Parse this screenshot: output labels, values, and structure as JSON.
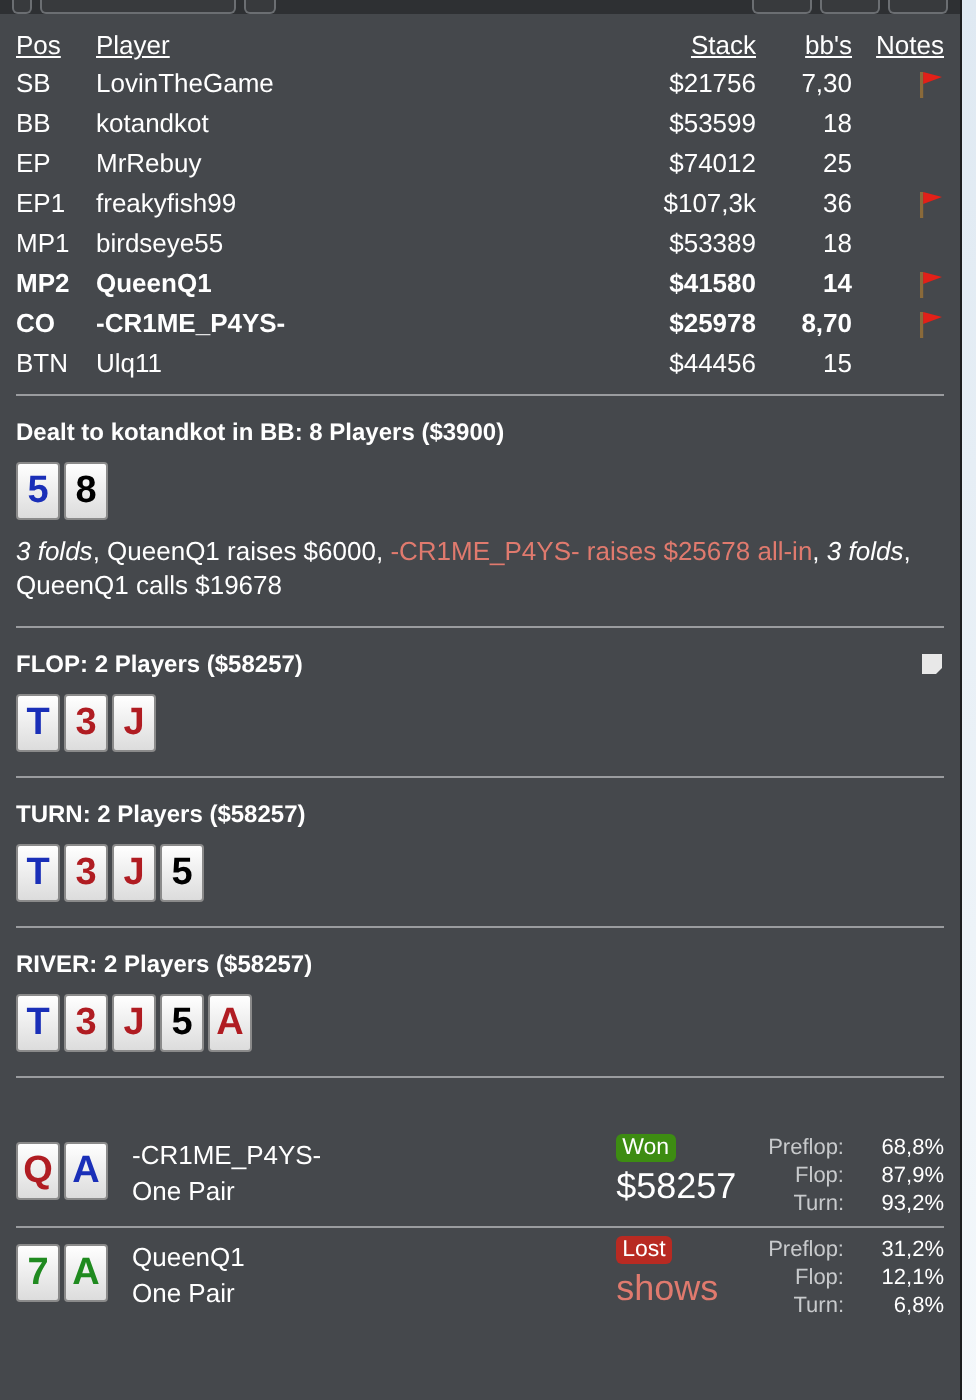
{
  "columns": [
    "Pos",
    "Player",
    "Stack",
    "bb's",
    "Notes"
  ],
  "players": [
    {
      "pos": "SB",
      "name": "LovinTheGame",
      "stack": "$21756",
      "bbs": "7,30",
      "highlighted": false,
      "flagged": true
    },
    {
      "pos": "BB",
      "name": "kotandkot",
      "stack": "$53599",
      "bbs": "18",
      "highlighted": false,
      "flagged": false
    },
    {
      "pos": "EP",
      "name": "MrRebuy",
      "stack": "$74012",
      "bbs": "25",
      "highlighted": false,
      "flagged": false
    },
    {
      "pos": "EP1",
      "name": "freakyfish99",
      "stack": "$107,3k",
      "bbs": "36",
      "highlighted": false,
      "flagged": true
    },
    {
      "pos": "MP1",
      "name": "birdseye55",
      "stack": "$53389",
      "bbs": "18",
      "highlighted": false,
      "flagged": false
    },
    {
      "pos": "MP2",
      "name": "QueenQ1",
      "stack": "$41580",
      "bbs": "14",
      "highlighted": true,
      "flagged": true
    },
    {
      "pos": "CO",
      "name": "-CR1ME_P4YS-",
      "stack": "$25978",
      "bbs": "8,70",
      "highlighted": true,
      "flagged": true
    },
    {
      "pos": "BTN",
      "name": "Ulq11",
      "stack": "$44456",
      "bbs": "15",
      "highlighted": false,
      "flagged": false
    }
  ],
  "streets": [
    {
      "title": "Dealt to kotandkot in BB: 8 Players ($3900)",
      "note": false,
      "cards": [
        {
          "rank": "5",
          "color": "#1a2fb8"
        },
        {
          "rank": "8",
          "color": "#000000"
        }
      ],
      "actions": [
        {
          "kind": "fold",
          "text": "3 folds"
        },
        {
          "kind": "plain",
          "text": ", QueenQ1 raises $6000, "
        },
        {
          "kind": "allin",
          "text": "-CR1ME_P4YS- raises $25678 all-in"
        },
        {
          "kind": "plain",
          "text": ", "
        },
        {
          "kind": "fold",
          "text": "3 folds"
        },
        {
          "kind": "plain",
          "text": ", QueenQ1 calls $19678"
        }
      ]
    },
    {
      "title": "FLOP: 2 Players ($58257)",
      "note": true,
      "cards": [
        {
          "rank": "T",
          "color": "#1a2fb8"
        },
        {
          "rank": "3",
          "color": "#b01c22"
        },
        {
          "rank": "J",
          "color": "#b01c22"
        }
      ]
    },
    {
      "title": "TURN: 2 Players ($58257)",
      "note": false,
      "cards": [
        {
          "rank": "T",
          "color": "#1a2fb8"
        },
        {
          "rank": "3",
          "color": "#b01c22"
        },
        {
          "rank": "J",
          "color": "#b01c22"
        },
        {
          "rank": "5",
          "color": "#000000"
        }
      ]
    },
    {
      "title": "RIVER: 2 Players ($58257)",
      "note": false,
      "cards": [
        {
          "rank": "T",
          "color": "#1a2fb8"
        },
        {
          "rank": "3",
          "color": "#b01c22"
        },
        {
          "rank": "J",
          "color": "#b01c22"
        },
        {
          "rank": "5",
          "color": "#000000"
        },
        {
          "rank": "A",
          "color": "#b01c22"
        }
      ]
    }
  ],
  "results": [
    {
      "cards": [
        {
          "rank": "Q",
          "color": "#b01c22"
        },
        {
          "rank": "A",
          "color": "#1a2fb8"
        }
      ],
      "player": "-CR1ME_P4YS-",
      "hand": "One Pair",
      "kind": "won",
      "badge": "Won",
      "amount": "$58257",
      "equity": [
        {
          "label": "Preflop:",
          "value": "68,8%"
        },
        {
          "label": "Flop:",
          "value": "87,9%"
        },
        {
          "label": "Turn:",
          "value": "93,2%"
        }
      ]
    },
    {
      "cards": [
        {
          "rank": "7",
          "color": "#1f8a1f"
        },
        {
          "rank": "A",
          "color": "#1f8a1f"
        }
      ],
      "player": "QueenQ1",
      "hand": "One Pair",
      "kind": "lost",
      "badge": "Lost",
      "amount": "shows",
      "equity": [
        {
          "label": "Preflop:",
          "value": "31,2%"
        },
        {
          "label": "Flop:",
          "value": "12,1%"
        },
        {
          "label": "Turn:",
          "value": "6,8%"
        }
      ]
    }
  ]
}
